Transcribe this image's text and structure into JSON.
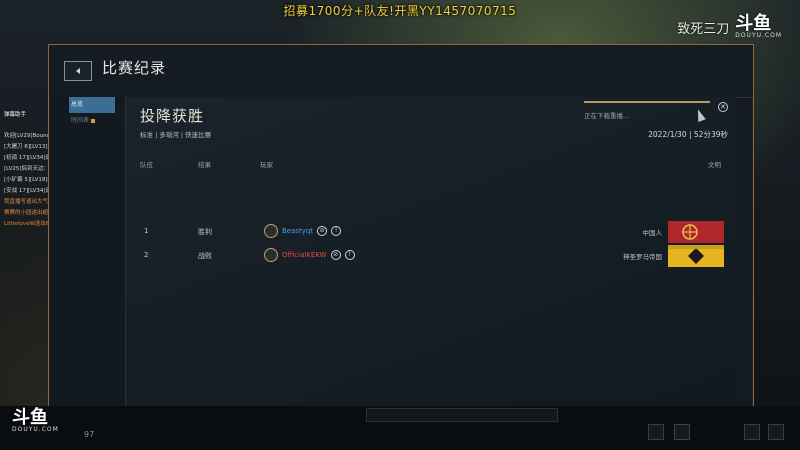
{
  "stream": {
    "banner": "招募1700分+队友!开黑YY1457070715",
    "watermark_text": "致死三刀",
    "logo": "斗鱼",
    "logo_sub": "DOUYU.COM"
  },
  "chat": {
    "assistant": "弹幕助手",
    "lines": [
      "欢迎[LV29]BoundLessNess.??.??进入直播间",
      "[大屠刀 6][LV13]虽吗不上ban民上什么：下午好",
      "[初孤 17][LV34]退陆秋天离别说：晚哟晚哟",
      "[LV25]侣到天边：撒想不到了。",
      "[小矿霸 5][LV18]红绢事不关可以音乐：这是谁来着?",
      "[安战 17][LV34]退陆秋天离别说：离团吧",
      "我直播写退出大气*1",
      "赛赛的小园送出超级宝藏*50",
      "LittleloveW送出666*1"
    ]
  },
  "dialog": {
    "title": "比赛纪录",
    "nav": {
      "overview": "总览",
      "timeline": "时间表"
    },
    "result_title": "投降获胜",
    "sub_info": "标准 | 多瑙河 | 快速比赛",
    "download_text": "正在下载重播...",
    "date": "2022/1/30",
    "duration": "52分39秒",
    "columns": {
      "team": "队伍",
      "result": "结果",
      "player": "玩家",
      "civ": "文明"
    },
    "rows": [
      {
        "team": "1",
        "result": "胜利",
        "player": "Beastyqt",
        "civ": "中国人",
        "name_color": "#4a9ee8"
      },
      {
        "team": "2",
        "result": "战败",
        "player": "OfficialKEKW",
        "civ": "神圣罗马帝国",
        "name_color": "#e04b3a"
      }
    ]
  },
  "hud": {
    "level": "97"
  }
}
